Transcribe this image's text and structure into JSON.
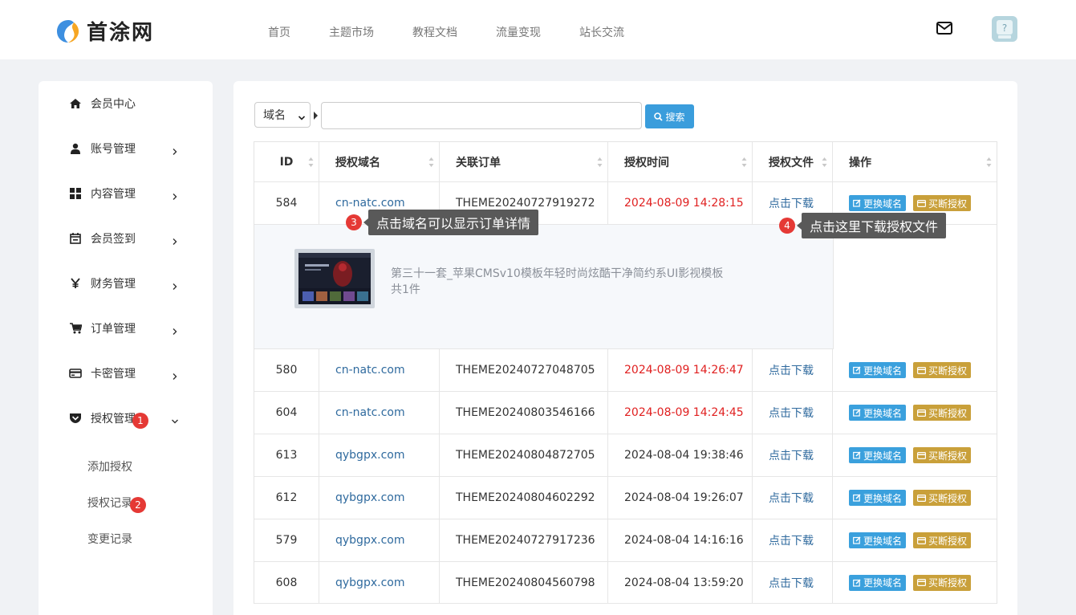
{
  "header": {
    "logo_text": "首涂网",
    "nav": [
      "首页",
      "主题市场",
      "教程文档",
      "流量变现",
      "站长交流"
    ]
  },
  "sidebar": {
    "items": [
      {
        "label": "会员中心",
        "icon": "home-icon"
      },
      {
        "label": "账号管理",
        "icon": "user-icon"
      },
      {
        "label": "内容管理",
        "icon": "grid-icon"
      },
      {
        "label": "会员签到",
        "icon": "calendar-icon"
      },
      {
        "label": "财务管理",
        "icon": "yen-icon"
      },
      {
        "label": "订单管理",
        "icon": "cart-icon"
      },
      {
        "label": "卡密管理",
        "icon": "card-icon"
      },
      {
        "label": "授权管理",
        "icon": "shield-icon"
      }
    ],
    "sub_items": [
      "添加授权",
      "授权记录",
      "变更记录"
    ],
    "badges": [
      "1",
      "2"
    ]
  },
  "search": {
    "select_value": "域名",
    "placeholder": "",
    "button_label": "搜索"
  },
  "table": {
    "headers": [
      "ID",
      "授权域名",
      "关联订单",
      "授权时间",
      "授权文件",
      "操作"
    ],
    "rows": [
      {
        "id": "584",
        "domain": "cn-natc.com",
        "order": "THEME20240727919272",
        "time": "2024-08-09 14:28:15",
        "file": "点击下载",
        "red": true
      },
      {
        "id": "580",
        "domain": "cn-natc.com",
        "order": "THEME20240727048705",
        "time": "2024-08-09 14:26:47",
        "file": "点击下载",
        "red": true
      },
      {
        "id": "604",
        "domain": "cn-natc.com",
        "order": "THEME20240803546166",
        "time": "2024-08-09 14:24:45",
        "file": "点击下载",
        "red": true
      },
      {
        "id": "613",
        "domain": "qybgpx.com",
        "order": "THEME20240804872705",
        "time": "2024-08-04 19:38:46",
        "file": "点击下载",
        "red": false
      },
      {
        "id": "612",
        "domain": "qybgpx.com",
        "order": "THEME20240804602292",
        "time": "2024-08-04 19:26:07",
        "file": "点击下载",
        "red": false
      },
      {
        "id": "579",
        "domain": "qybgpx.com",
        "order": "THEME20240727917236",
        "time": "2024-08-04 14:16:16",
        "file": "点击下载",
        "red": false
      },
      {
        "id": "608",
        "domain": "qybgpx.com",
        "order": "THEME20240804560798",
        "time": "2024-08-04 13:59:20",
        "file": "点击下载",
        "red": false
      }
    ],
    "action_change": "更换域名",
    "action_buy": "买断授权",
    "detail": {
      "title": "第三十一套_苹果CMSv10模板年轻时尚炫酷干净简约系UI影视模板",
      "count": "共1件"
    }
  },
  "annotations": [
    {
      "num": "3",
      "text": "点击域名可以显示订单详情"
    },
    {
      "num": "4",
      "text": "点击这里下载授权文件"
    }
  ],
  "colors": {
    "accent_blue": "#3a9ddc",
    "gold": "#c9a03a",
    "red": "#e02020",
    "link": "#2f6a9e"
  }
}
